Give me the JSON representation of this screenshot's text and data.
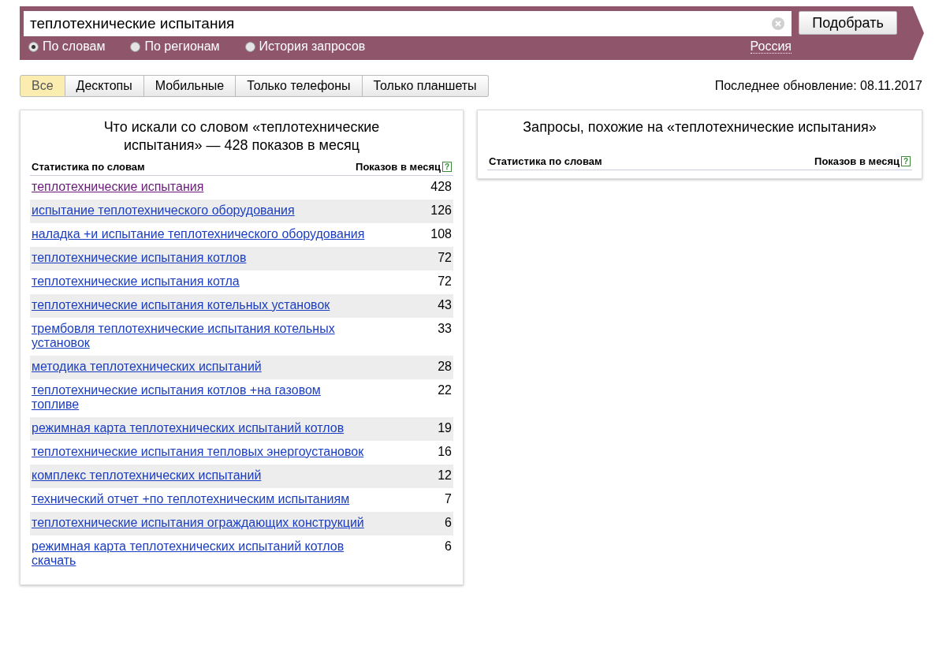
{
  "search": {
    "value": "теплотехнические испытания",
    "button": "Подобрать",
    "region": "Россия",
    "modes": [
      {
        "label": "По словам",
        "selected": true
      },
      {
        "label": "По регионам",
        "selected": false
      },
      {
        "label": "История запросов",
        "selected": false
      }
    ]
  },
  "tabs": [
    {
      "label": "Все",
      "selected": true
    },
    {
      "label": "Десктопы",
      "selected": false
    },
    {
      "label": "Мобильные",
      "selected": false
    },
    {
      "label": "Только телефоны",
      "selected": false
    },
    {
      "label": "Только планшеты",
      "selected": false
    }
  ],
  "last_update": "Последнее обновление: 08.11.2017",
  "left_panel": {
    "title": "Что искали со словом «теплотехнические испытания» — 428 показов в месяц",
    "columns": [
      "Статистика по словам",
      "Показов в месяц"
    ],
    "help": "?",
    "rows": [
      {
        "phrase": "теплотехнические испытания",
        "count": "428",
        "visited": true
      },
      {
        "phrase": "испытание теплотехнического оборудования",
        "count": "126",
        "visited": false
      },
      {
        "phrase": "наладка +и испытание теплотехнического оборудования",
        "count": "108",
        "visited": false
      },
      {
        "phrase": "теплотехнические испытания котлов",
        "count": "72",
        "visited": false
      },
      {
        "phrase": "теплотехнические испытания котла",
        "count": "72",
        "visited": false
      },
      {
        "phrase": "теплотехнические испытания котельных установок",
        "count": "43",
        "visited": false
      },
      {
        "phrase": "трембовля теплотехнические испытания котельных установок",
        "count": "33",
        "visited": false
      },
      {
        "phrase": "методика теплотехнических испытаний",
        "count": "28",
        "visited": false
      },
      {
        "phrase": "теплотехнические испытания котлов +на газовом топливе",
        "count": "22",
        "visited": false
      },
      {
        "phrase": "режимная карта теплотехнических испытаний котлов",
        "count": "19",
        "visited": false
      },
      {
        "phrase": "теплотехнические испытания тепловых энергоустановок",
        "count": "16",
        "visited": false
      },
      {
        "phrase": "комплекс теплотехнических испытаний",
        "count": "12",
        "visited": false
      },
      {
        "phrase": "технический отчет +по теплотехническим испытаниям",
        "count": "7",
        "visited": false
      },
      {
        "phrase": "теплотехнические испытания ограждающих конструкций",
        "count": "6",
        "visited": false
      },
      {
        "phrase": "режимная карта теплотехнических испытаний котлов скачать",
        "count": "6",
        "visited": false
      }
    ]
  },
  "right_panel": {
    "title": "Запросы, похожие на «теплотехнические испытания»",
    "columns": [
      "Статистика по словам",
      "Показов в месяц"
    ],
    "help": "?"
  }
}
